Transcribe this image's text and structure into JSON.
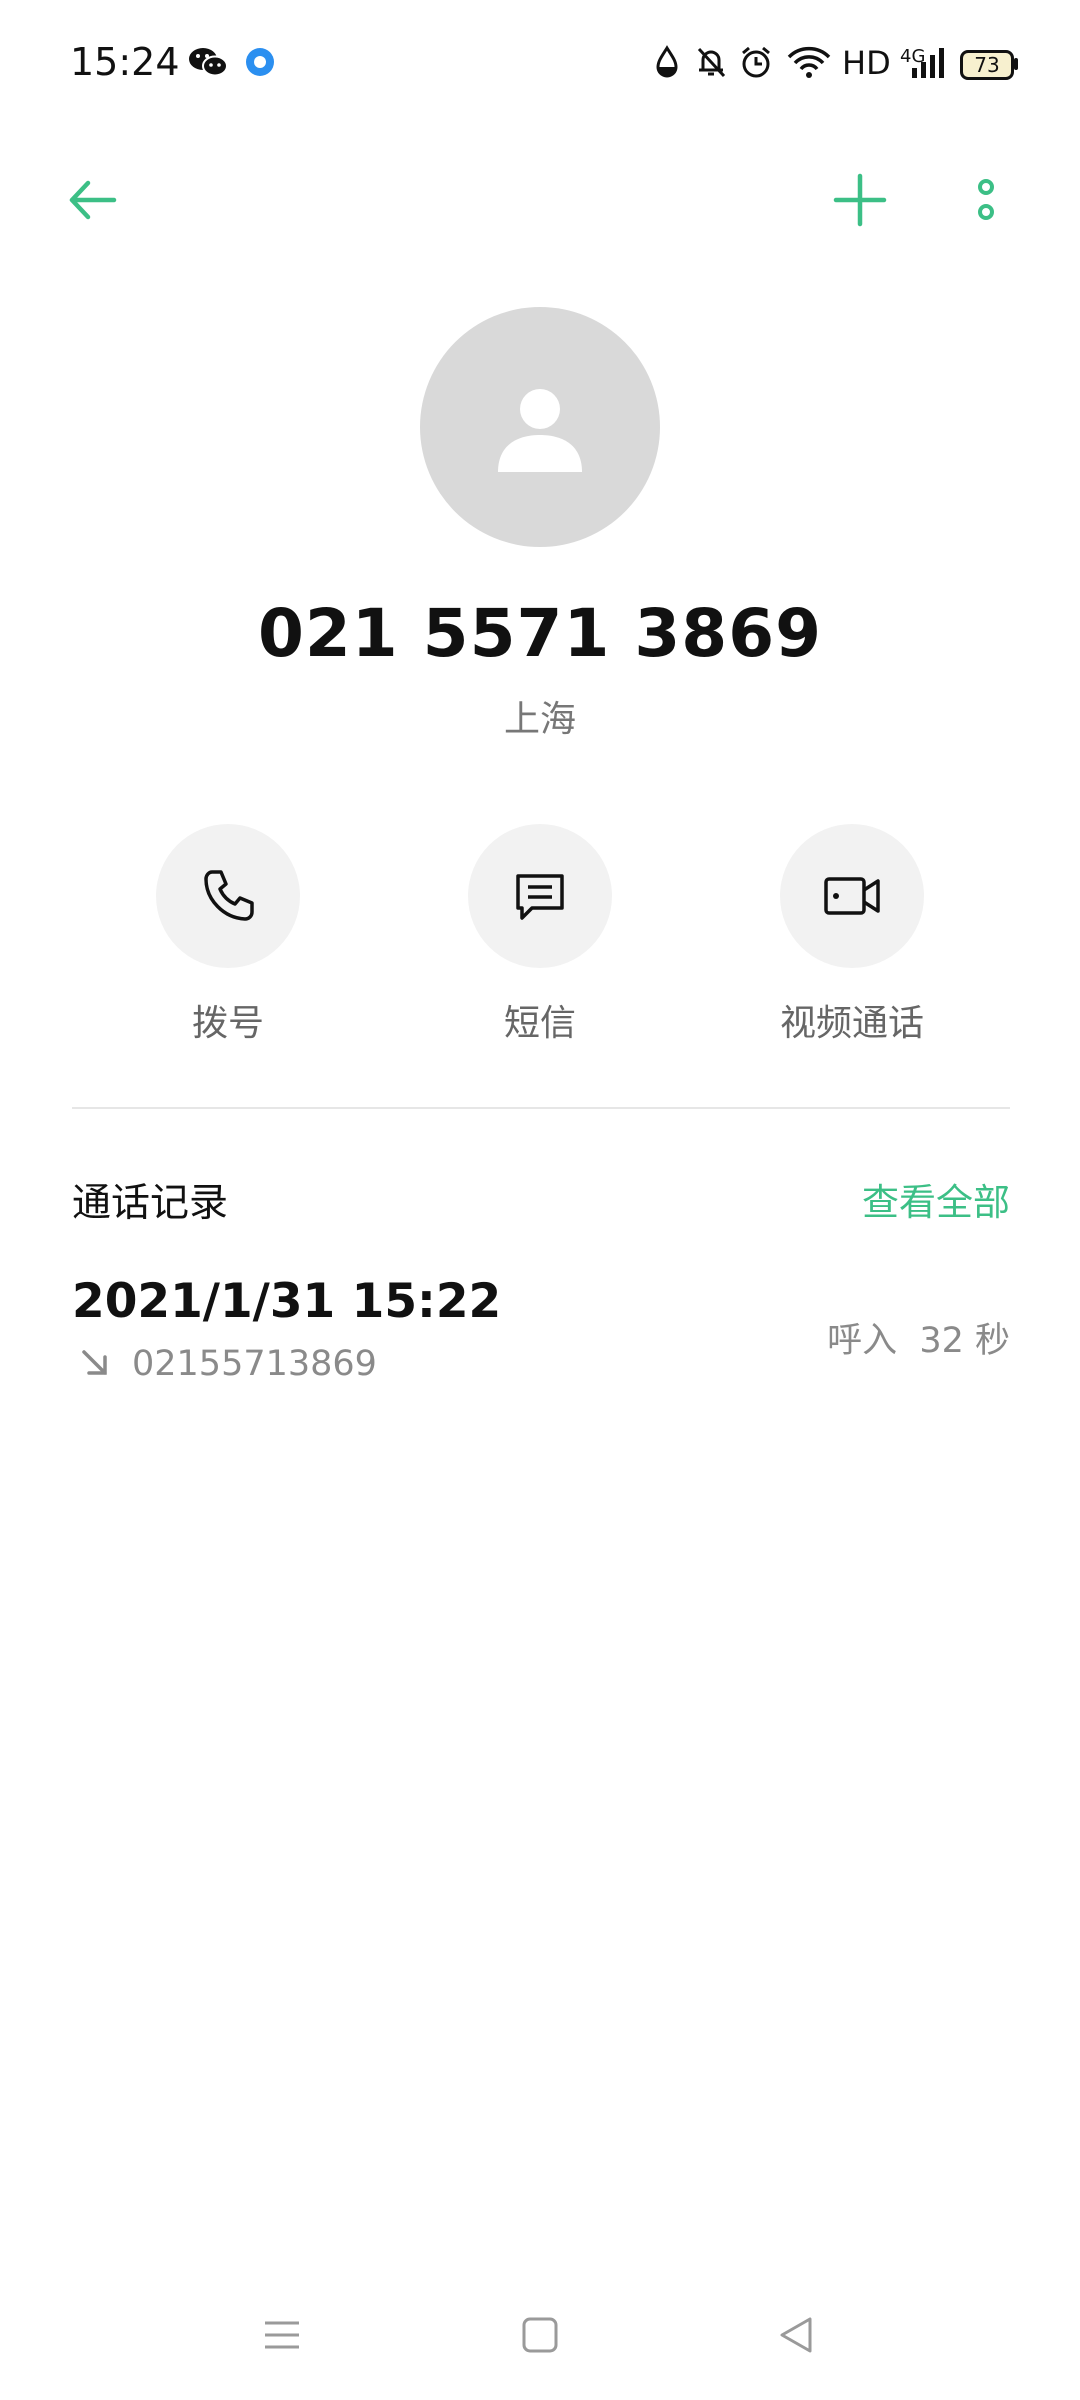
{
  "status_bar": {
    "time": "15:24",
    "network_type": "HD",
    "network_gen": "4G",
    "battery": "73",
    "icons": [
      "wechat-icon",
      "app-notification-icon",
      "water-drop-icon",
      "bell-off-icon",
      "alarm-icon",
      "wifi-icon",
      "signal-icon",
      "battery-icon"
    ]
  },
  "header": {
    "back_icon": "arrow-left-icon",
    "add_icon": "plus-icon",
    "more_icon": "more-vertical-icon",
    "accent_color": "#3cbf86"
  },
  "contact": {
    "number": "021 5571 3869",
    "location": "上海",
    "avatar_icon": "person-icon"
  },
  "actions": [
    {
      "label": "拨号",
      "icon": "phone-icon"
    },
    {
      "label": "短信",
      "icon": "message-icon"
    },
    {
      "label": "视频通话",
      "icon": "video-icon"
    }
  ],
  "call_log": {
    "title": "通话记录",
    "see_all": "查看全部",
    "entries": [
      {
        "datetime": "2021/1/31 15:22",
        "number": "02155713869",
        "direction_icon": "incoming-call-arrow-icon",
        "detail": "呼入  32 秒"
      }
    ]
  },
  "nav_bar": {
    "icons": [
      "menu-icon",
      "home-square-icon",
      "back-triangle-icon"
    ]
  }
}
